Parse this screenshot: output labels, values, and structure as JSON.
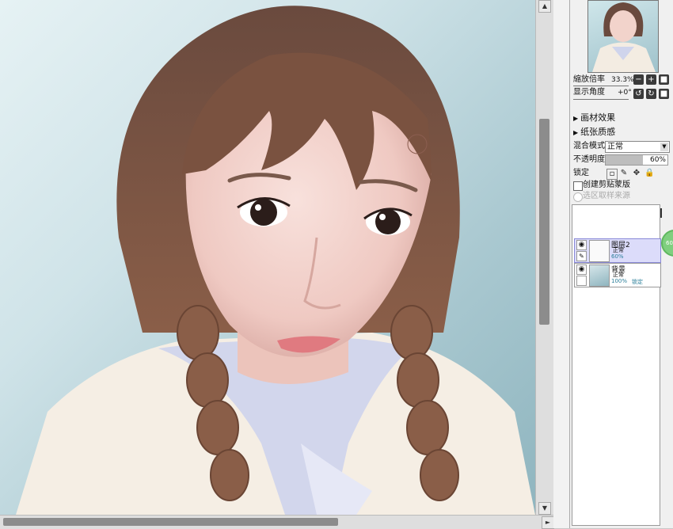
{
  "navigator": {
    "zoom_label": "縮放倍率",
    "zoom_value": "33.3%",
    "rotation_label": "显示角度",
    "rotation_value": "+0°"
  },
  "sections": {
    "material_effect": "画材效果",
    "paper_texture": "纸张质感"
  },
  "layer_props": {
    "blend_label": "混合模式",
    "blend_value": "正常",
    "opacity_label": "不透明度",
    "opacity_value": "60%",
    "opacity_fraction": 0.6,
    "lock_label": "锁定",
    "clip_label": "创建剪贴蒙版",
    "selection_source_label": "选区取样来源"
  },
  "layers": [
    {
      "name": "图层2",
      "mode": "正常",
      "opacity": "60%",
      "selected": true
    },
    {
      "name": "背景",
      "mode": "正常",
      "opacity": "100%",
      "lock": "锁定",
      "selected": false
    }
  ],
  "side_badge": "60",
  "colors": {
    "panel_bg": "#f0f0f0",
    "selected_layer": "#dcdcfa",
    "scroll_thumb": "#8c8c8c"
  }
}
